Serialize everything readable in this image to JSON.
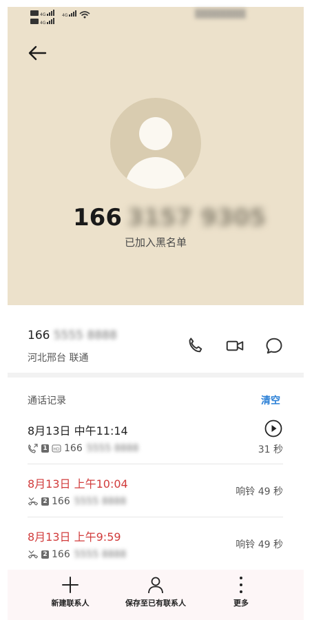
{
  "status_bar": {
    "left_text": "HD 4G 4G",
    "right_text": "▒▒▒▒▒▒▒▒"
  },
  "header": {
    "number_prefix": "166",
    "number_blurred": "3157 9305",
    "status": "已加入黑名单"
  },
  "contact": {
    "number_prefix": "166",
    "number_blurred": "5555 8888",
    "location": "河北邢台 联通"
  },
  "call_log": {
    "title": "通话记录",
    "clear_label": "清空",
    "entries": [
      {
        "date": "8月13日 中午11:14",
        "sim": "1",
        "number_prefix": "166",
        "number_blurred": "5555 8888",
        "right": "31 秒",
        "missed": false,
        "has_play": true
      },
      {
        "date": "8月13日 上午10:04",
        "sim": "2",
        "number_prefix": "166",
        "number_blurred": "5555 8888",
        "right": "响铃 49 秒",
        "missed": true,
        "has_play": false
      },
      {
        "date": "8月13日 上午9:59",
        "sim": "2",
        "number_prefix": "166",
        "number_blurred": "5555 8888",
        "right": "响铃 49 秒",
        "missed": true,
        "has_play": false
      }
    ]
  },
  "bottom_bar": {
    "new_contact": "新建联系人",
    "save_existing": "保存至已有联系人",
    "more": "更多"
  },
  "colors": {
    "header_bg": "#ece1cb",
    "missed_red": "#d13b3b",
    "accent_blue": "#2a7fd6"
  }
}
